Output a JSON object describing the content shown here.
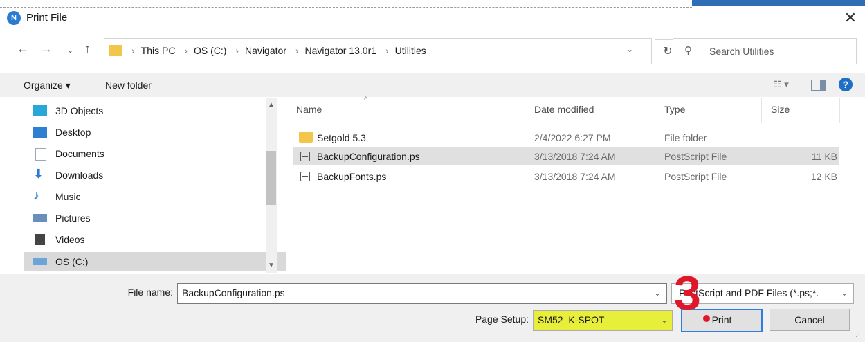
{
  "window": {
    "title": "Print File",
    "app_icon": "N"
  },
  "address": {
    "crumbs": [
      "This PC",
      "OS (C:)",
      "Navigator",
      "Navigator 13.0r1",
      "Utilities"
    ],
    "search_placeholder": "Search Utilities"
  },
  "toolbar": {
    "organize": "Organize ▾",
    "new_folder": "New folder"
  },
  "nav": {
    "items": [
      {
        "label": "3D Objects",
        "icon": "3d-objects-icon",
        "color": "#29a8d8"
      },
      {
        "label": "Desktop",
        "icon": "desktop-icon",
        "color": "#2e7fd0"
      },
      {
        "label": "Documents",
        "icon": "documents-icon",
        "color": "#9aa8b8"
      },
      {
        "label": "Downloads",
        "icon": "downloads-icon",
        "color": "#2b7bd1"
      },
      {
        "label": "Music",
        "icon": "music-icon",
        "color": "#2b7bd1"
      },
      {
        "label": "Pictures",
        "icon": "pictures-icon",
        "color": "#6a8fb8"
      },
      {
        "label": "Videos",
        "icon": "videos-icon",
        "color": "#444444"
      },
      {
        "label": "OS (C:)",
        "icon": "drive-icon",
        "color": "#6aa4d8"
      }
    ]
  },
  "files": {
    "columns": [
      "Name",
      "Date modified",
      "Type",
      "Size"
    ],
    "rows": [
      {
        "name": "Setgold 5.3",
        "date": "2/4/2022 6:27 PM",
        "type": "File folder",
        "size": "",
        "icon": "folder-icon"
      },
      {
        "name": "BackupConfiguration.ps",
        "date": "3/13/2018 7:24 AM",
        "type": "PostScript File",
        "size": "11 KB",
        "icon": "postscript-file-icon"
      },
      {
        "name": "BackupFonts.ps",
        "date": "3/13/2018 7:24 AM",
        "type": "PostScript File",
        "size": "12 KB",
        "icon": "postscript-file-icon"
      }
    ]
  },
  "form": {
    "file_name_label": "File name:",
    "file_name_value": "BackupConfiguration.ps",
    "file_type_value": "PostScript and PDF Files (*.ps;*.",
    "page_setup_label": "Page Setup:",
    "page_setup_value": "SM52_K-SPOT",
    "print_label": "Print",
    "cancel_label": "Cancel"
  },
  "annotation": {
    "text": "3",
    "color": "#e0162b"
  },
  "colors": {
    "highlight": "#e8ef3a",
    "accent": "#2f7de1"
  }
}
